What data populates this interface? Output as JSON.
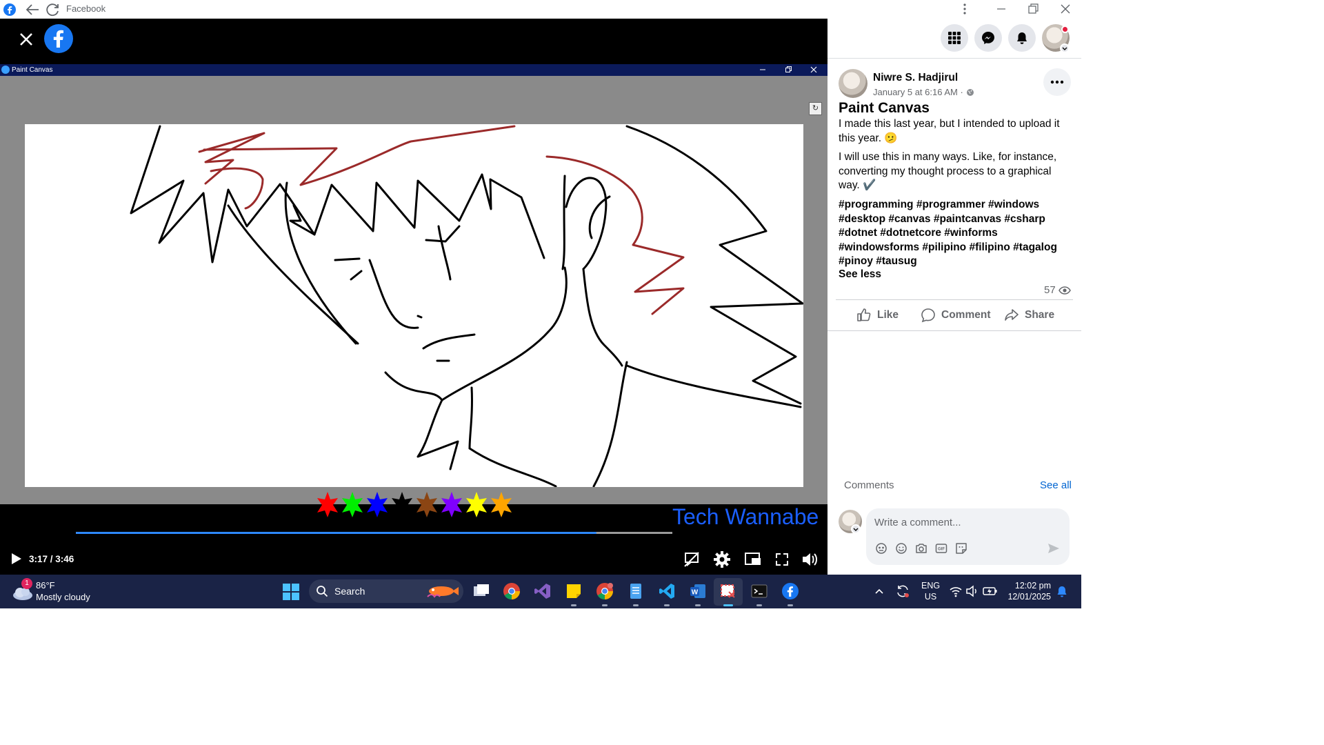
{
  "browser": {
    "title": "Facebook"
  },
  "paint_window": {
    "title": "Paint Canvas",
    "color_palette": [
      "#ff0000",
      "#00ee00",
      "#0000ff",
      "#000000",
      "#8b4513",
      "#7f00ff",
      "#ffff00",
      "#ffa500"
    ]
  },
  "video": {
    "watermark": "Tech Wannabe",
    "time": "3:17 / 3:46",
    "progress_fraction": 0.873,
    "buffered_fraction": 1.0
  },
  "post": {
    "author": "Niwre S. Hadjirul",
    "timestamp": "January 5 at 6:16 AM ·",
    "title": "Paint Canvas",
    "paragraph1": "I made this last year, but I intended to upload it this year. 🫤",
    "paragraph2": "I will use this in many ways. Like, for instance, converting my thought process to a graphical way. ✔️",
    "hashtags": "#programming #programmer #windows #desktop #canvas #paintcanvas #csharp #dotnet #dotnetcore #winforms #windowsforms #pilipino #filipino #tagalog #pinoy #tausug",
    "see_less": "See less",
    "views": "57",
    "actions": {
      "like": "Like",
      "comment": "Comment",
      "share": "Share"
    },
    "comments_header": "Comments",
    "see_all": "See all",
    "comment_placeholder": "Write a comment..."
  },
  "taskbar": {
    "weather_temp": "86°F",
    "weather_desc": "Mostly cloudy",
    "weather_badge": "1",
    "search_label": "Search",
    "lang": "ENG",
    "region": "US",
    "time": "12:02 pm",
    "date": "12/01/2025"
  }
}
